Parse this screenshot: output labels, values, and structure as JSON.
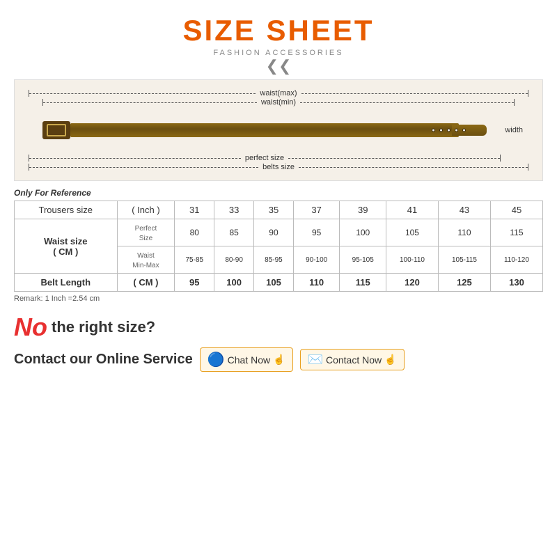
{
  "header": {
    "title": "SIZE SHEET",
    "subtitle": "FASHION ACCESSORIES",
    "chevron": "❯❯"
  },
  "belt_diagram": {
    "lines": [
      {
        "id": "waist_max",
        "label": "waist(max)"
      },
      {
        "id": "waist_min",
        "label": "waist(min)"
      },
      {
        "id": "perfect_size",
        "label": "perfect size"
      },
      {
        "id": "belts_size",
        "label": "belts size"
      }
    ],
    "width_label": "width"
  },
  "table": {
    "only_ref": "Only For Reference",
    "remark": "Remark: 1 Inch =2.54 cm",
    "col_headers": [
      "",
      "",
      "31",
      "33",
      "35",
      "37",
      "39",
      "41",
      "43",
      "45"
    ],
    "rows": [
      {
        "label": "Trousers size",
        "sub": "( Inch )",
        "values": [
          "31",
          "33",
          "35",
          "37",
          "39",
          "41",
          "43",
          "45"
        ]
      },
      {
        "label": "Waist size\n( CM )",
        "sub1_label": "Perfect\nSize",
        "sub1_values": [
          "80",
          "85",
          "90",
          "95",
          "100",
          "105",
          "110",
          "115"
        ],
        "sub2_label": "Waist\nMin-Max",
        "sub2_values": [
          "75-85",
          "80-90",
          "85-95",
          "90-100",
          "95-105",
          "100-110",
          "105-115",
          "110-120"
        ]
      },
      {
        "label": "Belt Length",
        "sub": "( CM )",
        "values": [
          "95",
          "100",
          "105",
          "110",
          "115",
          "120",
          "125",
          "130"
        ]
      }
    ]
  },
  "bottom": {
    "no_text": "No",
    "no_size_text": "the right size?",
    "contact_label": "Contact our Online Service",
    "chat_label": "Chat Now",
    "contact_now_label": "Contact Now"
  }
}
